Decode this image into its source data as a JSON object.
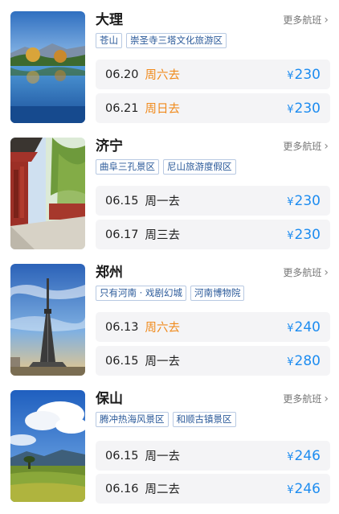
{
  "more_label": "更多航班",
  "currency": "¥",
  "colors": {
    "price": "#1d8cf0",
    "weekend": "#f08a1c",
    "tag_text": "#2b5a9a"
  },
  "cards": [
    {
      "city": "大理",
      "tags": [
        "苍山",
        "崇圣寺三塔文化旅游区"
      ],
      "flights": [
        {
          "date": "06.20",
          "weekday": "周六去",
          "weekend": true,
          "price": "230"
        },
        {
          "date": "06.21",
          "weekday": "周日去",
          "weekend": true,
          "price": "230"
        }
      ]
    },
    {
      "city": "济宁",
      "tags": [
        "曲阜三孔景区",
        "尼山旅游度假区"
      ],
      "flights": [
        {
          "date": "06.15",
          "weekday": "周一去",
          "weekend": false,
          "price": "230"
        },
        {
          "date": "06.17",
          "weekday": "周三去",
          "weekend": false,
          "price": "230"
        }
      ]
    },
    {
      "city": "郑州",
      "tags": [
        "只有河南 · 戏剧幻城",
        "河南博物院"
      ],
      "flights": [
        {
          "date": "06.13",
          "weekday": "周六去",
          "weekend": true,
          "price": "240"
        },
        {
          "date": "06.15",
          "weekday": "周一去",
          "weekend": false,
          "price": "280"
        }
      ]
    },
    {
      "city": "保山",
      "tags": [
        "腾冲热海风景区",
        "和顺古镇景区"
      ],
      "flights": [
        {
          "date": "06.15",
          "weekday": "周一去",
          "weekend": false,
          "price": "246"
        },
        {
          "date": "06.16",
          "weekday": "周二去",
          "weekend": false,
          "price": "246"
        }
      ]
    }
  ]
}
